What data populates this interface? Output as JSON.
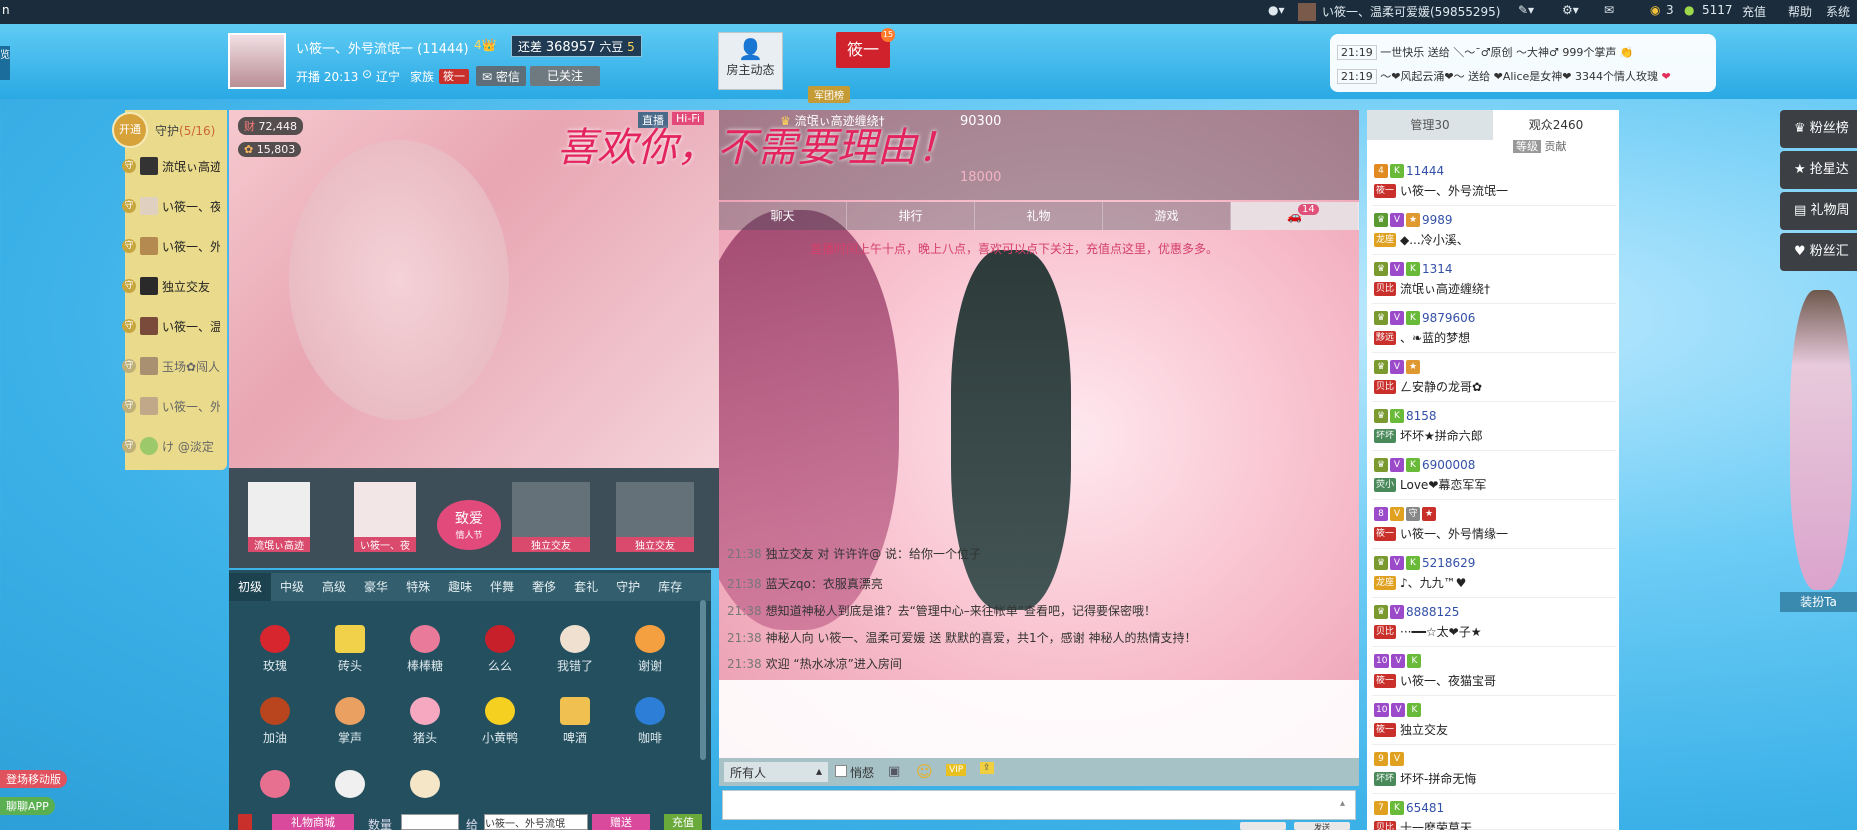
{
  "topbar": {
    "user_name": "い筱一、温柔可爱媛(59855295)",
    "coins_a": "3",
    "coins_b": "5117",
    "recharge": "充值",
    "help": "帮助",
    "system": "系统"
  },
  "room": {
    "host_name": "い筱一、外号流氓一 (11444)",
    "level_badge": "4",
    "still_diff_label": "还差",
    "still_diff_value": "368957",
    "diff_unit": "六豆",
    "diff_level": "5",
    "start_time": "开播 20:13",
    "location": "辽宁",
    "family_label": "家族",
    "family_name": "筱一",
    "private_msg": "密信",
    "followed": "已关注",
    "host_activity": "房主动态",
    "flag_name": "筱一",
    "flag_count": "15",
    "legion": "军团榜"
  },
  "notices": [
    {
      "time": "21:19",
      "text": "一世快乐 送给 ＼～¯♂原创 ～大神♂ 999个掌声"
    },
    {
      "time": "21:19",
      "text": "～❤风起云涌❤～ 送给 ❤Alice是女神❤ 3344个情人玫瑰"
    }
  ],
  "guard": {
    "open_label": "开通",
    "title": "守护",
    "count": "(5/16)",
    "items": [
      "流氓ぃ高迹",
      "い筱一、夜",
      "い筱一、外",
      "独立交友",
      "い筱一、温",
      "玉场✿闯人",
      "い筱一、外",
      "け @淡定"
    ]
  },
  "video": {
    "wealth": "72,448",
    "charm": "15,803",
    "live": "直播",
    "hifi": "Hi-Fi",
    "banner": "喜欢你，不需要理由！"
  },
  "guard_bar": [
    "流氓ぃ高迹",
    "い筱一、夜",
    "独立交友",
    "独立交友"
  ],
  "zhiai": "致爱",
  "zhiai_sub": "情人节",
  "rank": {
    "first_score": "90300",
    "third_score": "18000",
    "first_name": "流氓ぃ高迹缠绕†"
  },
  "gift_tabs": [
    "初级",
    "中级",
    "高级",
    "豪华",
    "特殊",
    "趣味",
    "伴舞",
    "奢侈",
    "套礼",
    "守护",
    "库存"
  ],
  "gifts": [
    "玫瑰",
    "砖头",
    "棒棒糖",
    "么么",
    "我错了",
    "谢谢",
    "加油",
    "掌声",
    "猪头",
    "小黄鸭",
    "啤酒",
    "咖啡"
  ],
  "gift_bottom": {
    "send_label": "礼物商城",
    "quantity_label": "数量",
    "to_label": "给",
    "target": "い筱一、外号流氓",
    "give": "赠送",
    "recharge": "充值"
  },
  "chat_tabs": [
    "聊天",
    "排行",
    "礼物",
    "游戏"
  ],
  "car_count": "14",
  "chat": {
    "welcome": "直播时间上午十点，晚上八点，喜欢可以点下关注，充值点这里，优惠多多。",
    "messages": [
      {
        "time": "21:38",
        "text": "独立交友 对 许许许@ 说：给你一个位子"
      },
      {
        "time": "21:38",
        "text": "蓝天zqo：衣服真漂亮"
      },
      {
        "time": "21:38",
        "text": "想知道神秘人到底是谁？去“管理中心–来往帐单”查看吧，记得要保密哦！"
      },
      {
        "time": "21:38",
        "text": "神秘人向 い筱一、温柔可爱媛 送 默默的喜爱，共1个，感谢 神秘人的热情支持！"
      },
      {
        "time": "21:38",
        "text": "欢迎 “热水冰凉”进入房间"
      }
    ],
    "target": "所有人",
    "whisper": "悄惄",
    "send": "发送"
  },
  "right": {
    "tab_manage": "管理30",
    "tab_audience": "观众2460",
    "sub_level": "等级",
    "sub_contrib": "贡献",
    "users": [
      {
        "num": "11444",
        "tag": "筱一",
        "name": "い筱一、外号流氓一"
      },
      {
        "num": "9989",
        "tag": "龙座",
        "name": "◆...冷小溪、"
      },
      {
        "num": "1314",
        "tag": "贝比",
        "name": "流氓ぃ高迹缠绕†"
      },
      {
        "num": "9879606",
        "tag": "黟远",
        "name": "、❧蓝的梦想"
      },
      {
        "num": "",
        "tag": "贝比",
        "name": "ㄥ安静の龙哥✿"
      },
      {
        "num": "8158",
        "tag": "坏坏",
        "name": "坏坏★拼命六郎"
      },
      {
        "num": "6900008",
        "tag": "荧小",
        "name": "Love❤幕恋军军"
      },
      {
        "num": "",
        "tag": "筱一",
        "name": "い筱一、外号情缘一"
      },
      {
        "num": "5218629",
        "tag": "龙座",
        "name": "♪、九九™♥"
      },
      {
        "num": "8888125",
        "tag": "贝比",
        "name": "···━━☆太❤子★"
      },
      {
        "num": "",
        "tag": "筱一",
        "name": "い筱一、夜猫宝哥"
      },
      {
        "num": "",
        "tag": "筱一",
        "name": "独立交友"
      },
      {
        "num": "",
        "tag": "坏坏",
        "name": "坏坏-拼命无悔"
      },
      {
        "num": "65481",
        "tag": "贝比",
        "name": "十一麽荣莫天"
      }
    ]
  },
  "side": {
    "btn1": "粉丝榜",
    "btn2": "抢星达",
    "btn3": "礼物周",
    "btn4": "粉丝汇",
    "dress": "装扮Ta"
  },
  "left_bottom": {
    "mobile": "登场移动版",
    "app": "聊聊APP"
  }
}
